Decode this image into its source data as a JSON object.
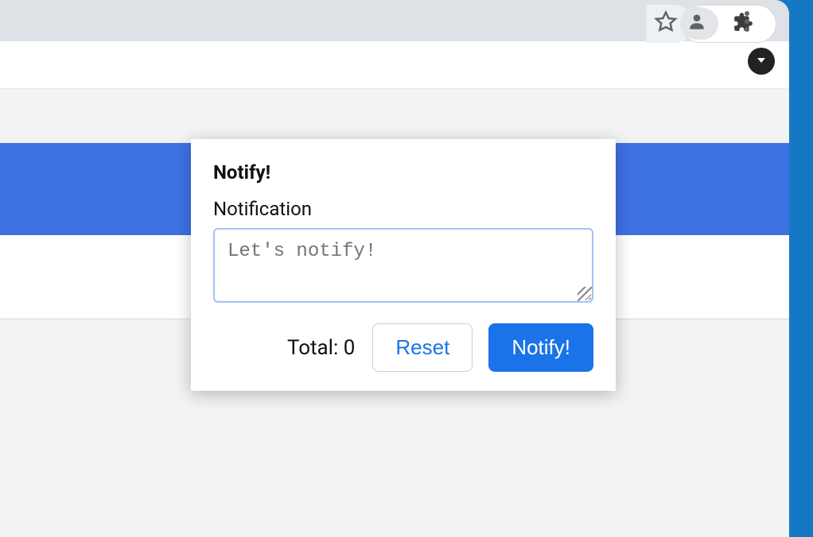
{
  "titlebar": {},
  "toolbar": {
    "icons": {
      "star": "star-icon",
      "bell": "bell-icon",
      "puzzle": "puzzle-icon",
      "profile": "profile-icon",
      "kebab": "kebab-icon",
      "dropdown": "dropdown-icon"
    }
  },
  "popup": {
    "title": "Notify!",
    "label": "Notification",
    "placeholder": "Let's notify!",
    "value": "",
    "total_label": "Total:",
    "total_value": "0",
    "reset_label": "Reset",
    "notify_label": "Notify!"
  },
  "colors": {
    "accent": "#1a73e8",
    "blue_strip": "#3e71e2",
    "bg": "#1578c4"
  }
}
